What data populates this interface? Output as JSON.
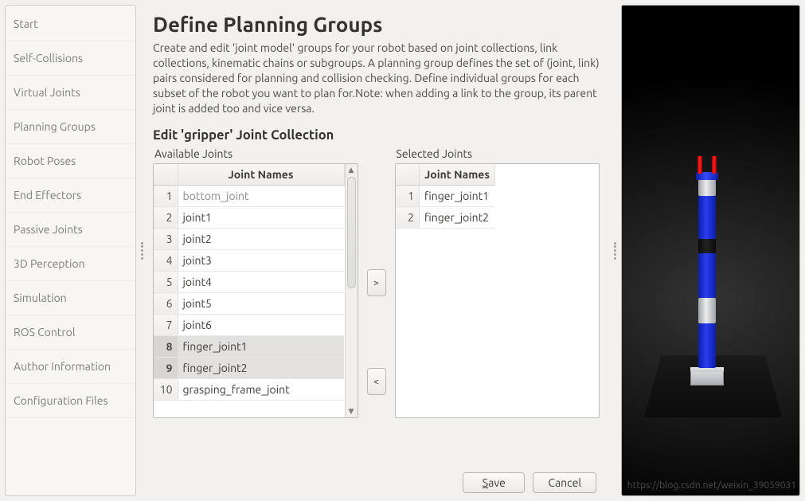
{
  "sidebar": {
    "items": [
      {
        "label": "Start"
      },
      {
        "label": "Self-Collisions"
      },
      {
        "label": "Virtual Joints"
      },
      {
        "label": "Planning Groups"
      },
      {
        "label": "Robot Poses"
      },
      {
        "label": "End Effectors"
      },
      {
        "label": "Passive Joints"
      },
      {
        "label": "3D Perception"
      },
      {
        "label": "Simulation"
      },
      {
        "label": "ROS Control"
      },
      {
        "label": "Author Information"
      },
      {
        "label": "Configuration Files"
      }
    ]
  },
  "main": {
    "heading": "Define Planning Groups",
    "description": "Create and edit 'joint model' groups for your robot based on joint collections, link collections, kinematic chains or subgroups. A planning group defines the set of (joint, link) pairs considered for planning and collision checking. Define individual groups for each subset of the robot you want to plan for.Note: when adding a link to the group, its parent joint is added too and vice versa.",
    "subheading": "Edit 'gripper' Joint Collection",
    "available_label": "Available Joints",
    "selected_label": "Selected Joints",
    "column_header": "Joint Names",
    "available": [
      {
        "n": "1",
        "name": "bottom_joint"
      },
      {
        "n": "2",
        "name": "joint1"
      },
      {
        "n": "3",
        "name": "joint2"
      },
      {
        "n": "4",
        "name": "joint3"
      },
      {
        "n": "5",
        "name": "joint4"
      },
      {
        "n": "6",
        "name": "joint5"
      },
      {
        "n": "7",
        "name": "joint6"
      },
      {
        "n": "8",
        "name": "finger_joint1"
      },
      {
        "n": "9",
        "name": "finger_joint2"
      },
      {
        "n": "10",
        "name": "grasping_frame_joint"
      }
    ],
    "selected": [
      {
        "n": "1",
        "name": "finger_joint1"
      },
      {
        "n": "2",
        "name": "finger_joint2"
      }
    ],
    "add_label": ">",
    "remove_label": "<",
    "save_label": "Save",
    "cancel_label": "Cancel"
  },
  "watermark": "https://blog.csdn.net/weixin_39059031"
}
